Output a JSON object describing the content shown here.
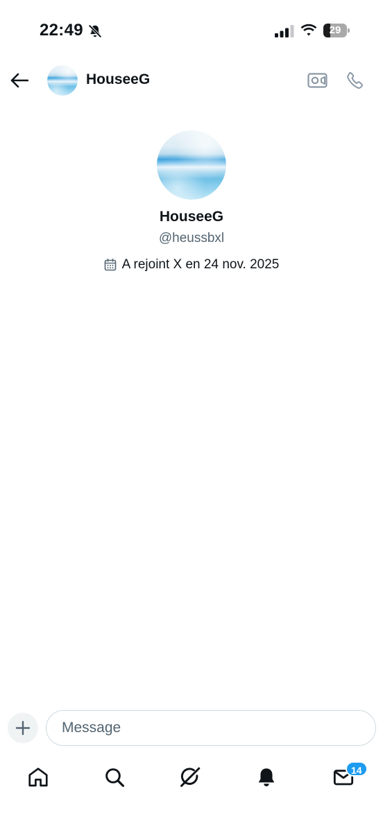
{
  "status_bar": {
    "time": "22:49",
    "battery_level": "29",
    "battery_fraction": 0.29,
    "icons": [
      "bell-off-icon",
      "signal-icon",
      "wifi-icon",
      "battery-icon"
    ]
  },
  "header": {
    "contact_name": "HouseeG",
    "icons": [
      "back-arrow-icon",
      "video-camera-icon",
      "phone-icon"
    ]
  },
  "profile": {
    "name": "HouseeG",
    "handle": "@heussbxl",
    "joined_text": "A rejoint X en 24 nov. 2025",
    "icons": [
      "calendar-icon"
    ]
  },
  "composer": {
    "placeholder": "Message",
    "value": "",
    "icons": [
      "plus-icon"
    ]
  },
  "bottom_nav": {
    "items": [
      "home-icon",
      "search-icon",
      "grok-icon",
      "notifications-icon",
      "messages-icon"
    ],
    "messages_badge": "14"
  },
  "colors": {
    "accent": "#1d9bf0",
    "text_primary": "#0f1419",
    "text_secondary": "#536471",
    "icon_muted": "#8b98a5",
    "input_border": "#cfd9de"
  }
}
